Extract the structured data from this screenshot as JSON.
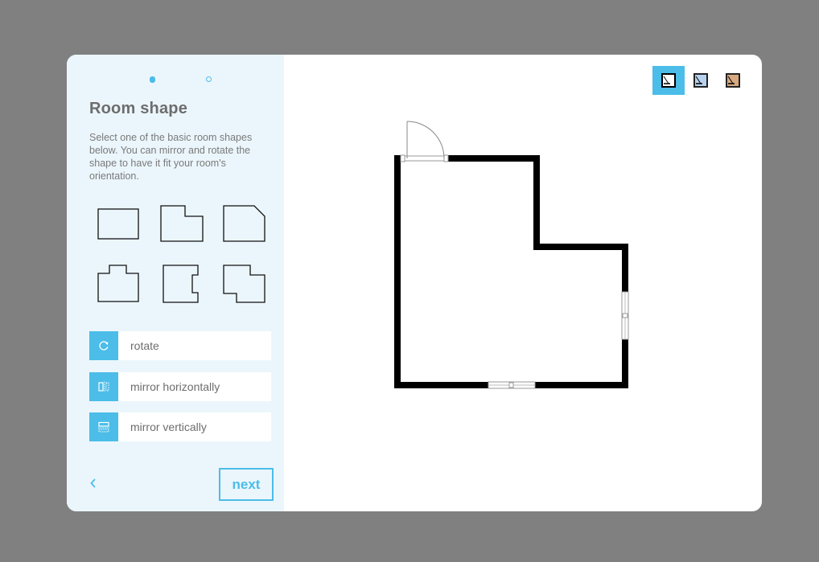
{
  "steps": {
    "total": 2,
    "current": 1
  },
  "panel": {
    "title": "Room shape",
    "description": "Select one of the basic room shapes below. You can mirror and rotate the shape to have it fit your room's orientation."
  },
  "shapes": [
    "rectangle",
    "l-shape-notch-top-right",
    "cut-corner",
    "t-shape",
    "notch-right",
    "notch-corners"
  ],
  "actions": {
    "rotate": "rotate",
    "mirror_h": "mirror horizontally",
    "mirror_v": "mirror vertically"
  },
  "nav": {
    "back_icon": "chevron-left-icon",
    "next_label": "next"
  },
  "view_modes": [
    {
      "name": "line-view",
      "selected": true
    },
    {
      "name": "blue-view",
      "selected": false
    },
    {
      "name": "wood-view",
      "selected": false
    }
  ],
  "colors": {
    "accent": "#4bbde8",
    "panel_bg": "#ebf6fc",
    "wall": "#000000",
    "backdrop": "#808080"
  }
}
